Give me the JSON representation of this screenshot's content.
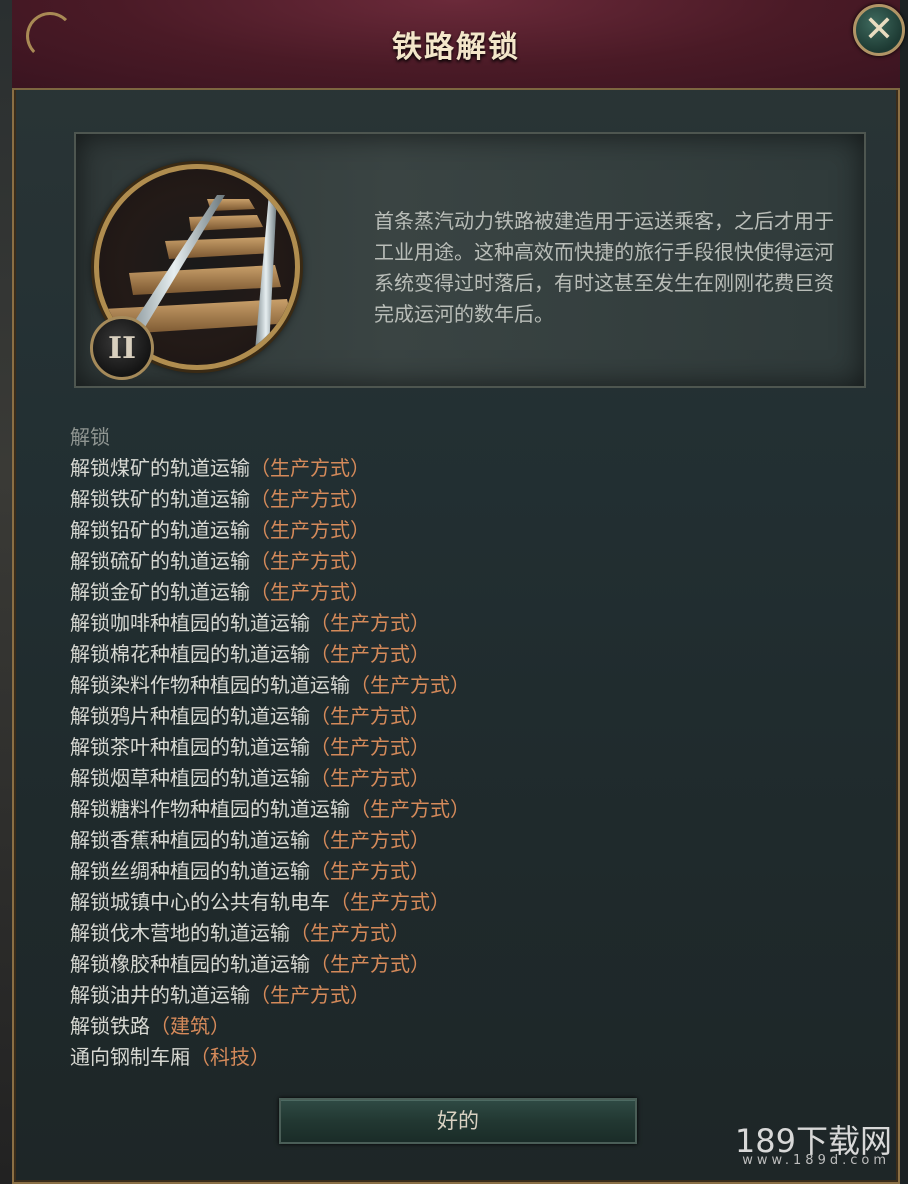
{
  "dialog": {
    "title": "铁路解锁",
    "close_icon": "close-icon"
  },
  "info": {
    "tier": "II",
    "emblem_icon": "railway-track-icon",
    "description": "首条蒸汽动力铁路被建造用于运送乘客，之后才用于工业用途。这种高效而快捷的旅行手段很快使得运河系统变得过时落后，有时这甚至发生在刚刚花费巨资完成运河的数年后。"
  },
  "unlocks": {
    "heading": "解锁",
    "items": [
      {
        "text": "解锁煤矿的轨道运输",
        "category": "（生产方式）"
      },
      {
        "text": "解锁铁矿的轨道运输",
        "category": "（生产方式）"
      },
      {
        "text": "解锁铅矿的轨道运输",
        "category": "（生产方式）"
      },
      {
        "text": "解锁硫矿的轨道运输",
        "category": "（生产方式）"
      },
      {
        "text": "解锁金矿的轨道运输",
        "category": "（生产方式）"
      },
      {
        "text": "解锁咖啡种植园的轨道运输",
        "category": "（生产方式）"
      },
      {
        "text": "解锁棉花种植园的轨道运输",
        "category": "（生产方式）"
      },
      {
        "text": "解锁染料作物种植园的轨道运输",
        "category": "（生产方式）"
      },
      {
        "text": "解锁鸦片种植园的轨道运输",
        "category": "（生产方式）"
      },
      {
        "text": "解锁茶叶种植园的轨道运输",
        "category": "（生产方式）"
      },
      {
        "text": "解锁烟草种植园的轨道运输",
        "category": "（生产方式）"
      },
      {
        "text": "解锁糖料作物种植园的轨道运输",
        "category": "（生产方式）"
      },
      {
        "text": "解锁香蕉种植园的轨道运输",
        "category": "（生产方式）"
      },
      {
        "text": "解锁丝绸种植园的轨道运输",
        "category": "（生产方式）"
      },
      {
        "text": "解锁城镇中心的公共有轨电车",
        "category": "（生产方式）"
      },
      {
        "text": "解锁伐木营地的轨道运输",
        "category": "（生产方式）"
      },
      {
        "text": "解锁橡胶种植园的轨道运输",
        "category": "（生产方式）"
      },
      {
        "text": "解锁油井的轨道运输",
        "category": "（生产方式）"
      },
      {
        "text": "解锁铁路",
        "category": "（建筑）"
      },
      {
        "text": "通向钢制车厢",
        "category": "（科技）"
      }
    ]
  },
  "ok_button": "好的",
  "watermark": {
    "name": "189下载网",
    "url": "www.189d.com"
  }
}
